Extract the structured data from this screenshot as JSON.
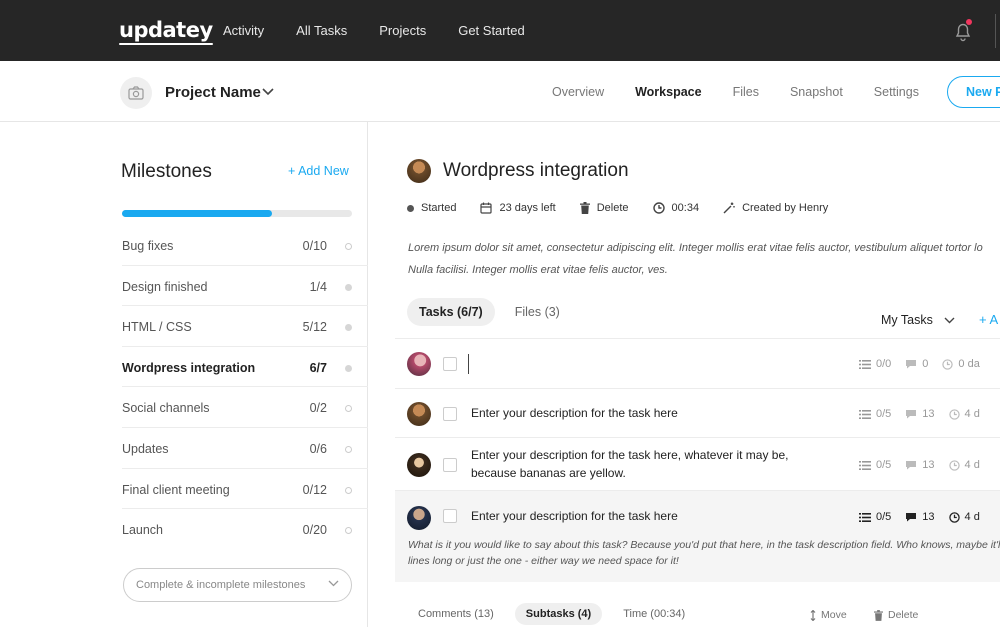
{
  "app": {
    "logo": "updatey"
  },
  "topnav": [
    "Activity",
    "All Tasks",
    "Projects",
    "Get Started"
  ],
  "project": {
    "name": "Project Name",
    "tabs": [
      "Overview",
      "Workspace",
      "Files",
      "Snapshot",
      "Settings"
    ],
    "active_tab": "Workspace",
    "new_button": "New Pr"
  },
  "milestones": {
    "title": "Milestones",
    "add_new": "Add New",
    "progress_percent": 65,
    "items": [
      {
        "name": "Bug fixes",
        "count": "0/10",
        "dot": "empty"
      },
      {
        "name": "Design finished",
        "count": "1/4",
        "dot": "filled"
      },
      {
        "name": "HTML / CSS",
        "count": "5/12",
        "dot": "filled"
      },
      {
        "name": "Wordpress integration",
        "count": "6/7",
        "dot": "filled",
        "active": true
      },
      {
        "name": "Social channels",
        "count": "0/2",
        "dot": "empty"
      },
      {
        "name": "Updates",
        "count": "0/6",
        "dot": "empty"
      },
      {
        "name": "Final client meeting",
        "count": "0/12",
        "dot": "empty"
      },
      {
        "name": "Launch",
        "count": "0/20",
        "dot": "empty"
      }
    ],
    "filter": "Complete & incomplete milestones"
  },
  "task": {
    "title": "Wordpress integration",
    "meta": {
      "status": "Started",
      "days_left": "23 days left",
      "delete": "Delete",
      "time": "00:34",
      "created_by": "Created by Henry"
    },
    "description_line1": "Lorem ipsum dolor sit amet, consectetur adipiscing elit. Integer mollis erat vitae felis auctor, vestibulum aliquet tortor lo",
    "description_line2": "Nulla facilisi.  Integer mollis erat vitae felis auctor, ves."
  },
  "tabs": {
    "tasks": "Tasks (6/7)",
    "files": "Files (3)",
    "my_tasks": "My Tasks",
    "add": "+ A"
  },
  "tasks": [
    {
      "text": "",
      "subtasks": "0/0",
      "comments": "0",
      "days": "0 da"
    },
    {
      "text": "Enter your description for the task here",
      "subtasks": "0/5",
      "comments": "13",
      "days": "4 d"
    },
    {
      "text_line1": "Enter your description for the task here, whatever it may be,",
      "text_line2": "because bananas are yellow.",
      "subtasks": "0/5",
      "comments": "13",
      "days": "4 d"
    },
    {
      "text": "Enter your description for the task here",
      "subtasks": "0/5",
      "comments": "13",
      "days": "4 d",
      "note_line1": "What is it you would like to say about this task? Because you'd put that here, in the task description field. Who knows, maybe it'll b",
      "note_line2": "lines long or just the one - either way we need space for it!"
    }
  ],
  "subtabs": {
    "comments": "Comments (13)",
    "subtasks": "Subtasks (4)",
    "time": "Time (00:34)",
    "move": "Move",
    "delete": "Delete"
  },
  "colors": {
    "accent": "#1aa9f0",
    "topbar": "#262626",
    "notification": "#f2365e"
  }
}
